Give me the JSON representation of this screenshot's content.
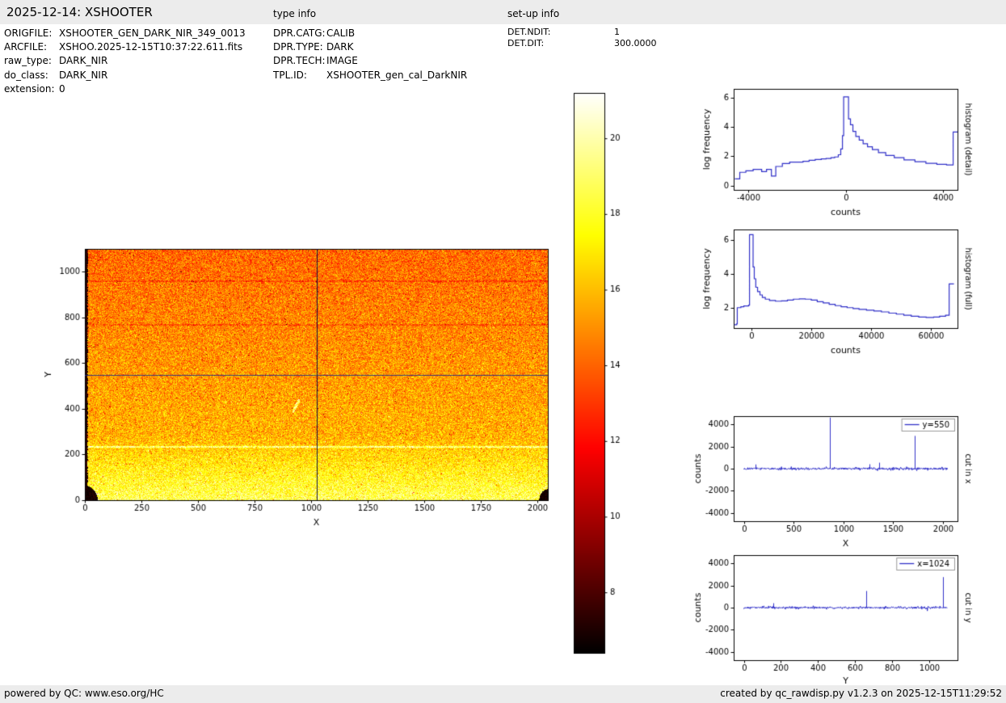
{
  "header": {
    "title": "2025-12-14: XSHOOTER",
    "type_info_label": "type info",
    "setup_info_label": "set-up info"
  },
  "metadata": {
    "left": [
      {
        "label": "ORIGFILE:",
        "value": "XSHOOTER_GEN_DARK_NIR_349_0013"
      },
      {
        "label": "ARCFILE:",
        "value": "XSHOO.2025-12-15T10:37:22.611.fits"
      },
      {
        "label": "raw_type:",
        "value": "DARK_NIR"
      },
      {
        "label": "do_class:",
        "value": "DARK_NIR"
      },
      {
        "label": "extension:",
        "value": "0"
      }
    ],
    "type_info": [
      {
        "label": "DPR.CATG:",
        "value": "CALIB"
      },
      {
        "label": "DPR.TYPE:",
        "value": "DARK"
      },
      {
        "label": "DPR.TECH:",
        "value": "IMAGE"
      },
      {
        "label": "TPL.ID:",
        "value": "XSHOOTER_gen_cal_DarkNIR"
      }
    ],
    "setup_info": [
      {
        "label": "DET.NDIT:",
        "value": "1"
      },
      {
        "label": "DET.DIT:",
        "value": "300.0000"
      }
    ]
  },
  "footer": {
    "left": "powered by QC: www.eso.org/HC",
    "right": "created by qc_rawdisp.py v1.2.3 on 2025-12-15T11:29:52"
  },
  "colors": {
    "plot_line": "#3030c8",
    "bar_background": "#ececec",
    "crosshair_vertical": "#14143c",
    "crosshair_horizontal": "#1b2a8a"
  },
  "chart_data": [
    {
      "id": "heatmap",
      "type": "heatmap",
      "xlabel": "X",
      "ylabel": "Y",
      "x_range": [
        0,
        2048
      ],
      "y_range": [
        0,
        1100
      ],
      "x_ticks": [
        0,
        250,
        500,
        750,
        1000,
        1250,
        1500,
        1750,
        2000
      ],
      "y_ticks": [
        0,
        200,
        400,
        600,
        800,
        1000
      ],
      "colormap": "hot",
      "value_range": [
        6.4,
        21.2
      ],
      "crosshair": {
        "x": 1024,
        "y": 550
      },
      "features": {
        "bright_row_y": 235,
        "dark_rows": [
          960,
          770
        ],
        "dark_left_edge": true,
        "dark_corners": [
          "bottom-left",
          "bottom-right"
        ],
        "bright_streak": {
          "x0": 915,
          "y0": 385,
          "x1": 950,
          "y1": 445
        }
      }
    },
    {
      "id": "colorbar",
      "type": "colorbar",
      "colormap": "hot",
      "range": [
        6.4,
        21.2
      ],
      "ticks": [
        8,
        10,
        12,
        14,
        16,
        18,
        20
      ]
    },
    {
      "id": "hist-detail",
      "type": "line",
      "xlabel": "counts",
      "ylabel": "log frequency",
      "right_label": "histogram (detail)",
      "x_range": [
        -4600,
        4600
      ],
      "y_range": [
        -0.3,
        6.6
      ],
      "x_ticks": [
        -4000,
        0,
        4000
      ],
      "y_ticks": [
        0,
        2,
        4,
        6
      ],
      "points": [
        [
          -4550,
          0.45
        ],
        [
          -4350,
          0.45
        ],
        [
          -4350,
          0.9
        ],
        [
          -4100,
          0.9
        ],
        [
          -4100,
          1.0
        ],
        [
          -3800,
          1.0
        ],
        [
          -3800,
          1.1
        ],
        [
          -3450,
          1.1
        ],
        [
          -3450,
          0.95
        ],
        [
          -3250,
          0.95
        ],
        [
          -3250,
          1.1
        ],
        [
          -3050,
          1.1
        ],
        [
          -3050,
          0.65
        ],
        [
          -2870,
          0.65
        ],
        [
          -2870,
          1.3
        ],
        [
          -2600,
          1.3
        ],
        [
          -2600,
          1.5
        ],
        [
          -2300,
          1.5
        ],
        [
          -2300,
          1.6
        ],
        [
          -2000,
          1.6
        ],
        [
          -1750,
          1.65
        ],
        [
          -1500,
          1.72
        ],
        [
          -1250,
          1.78
        ],
        [
          -1000,
          1.82
        ],
        [
          -800,
          1.85
        ],
        [
          -600,
          1.9
        ],
        [
          -450,
          1.95
        ],
        [
          -300,
          2.1
        ],
        [
          -200,
          2.5
        ],
        [
          -130,
          3.4
        ],
        [
          -80,
          6.05
        ],
        [
          60,
          6.05
        ],
        [
          120,
          4.55
        ],
        [
          200,
          4.15
        ],
        [
          300,
          3.7
        ],
        [
          420,
          3.35
        ],
        [
          560,
          3.1
        ],
        [
          720,
          2.85
        ],
        [
          900,
          2.65
        ],
        [
          1100,
          2.45
        ],
        [
          1350,
          2.25
        ],
        [
          1650,
          2.05
        ],
        [
          2000,
          1.9
        ],
        [
          2400,
          1.75
        ],
        [
          2850,
          1.62
        ],
        [
          3300,
          1.52
        ],
        [
          3750,
          1.45
        ],
        [
          4150,
          1.4
        ],
        [
          4380,
          1.4
        ],
        [
          4420,
          3.65
        ],
        [
          4600,
          3.65
        ]
      ]
    },
    {
      "id": "hist-full",
      "type": "line",
      "xlabel": "counts",
      "ylabel": "log frequency",
      "right_label": "histogram (full)",
      "x_range": [
        -6000,
        69000
      ],
      "y_range": [
        0.8,
        6.6
      ],
      "x_ticks": [
        0,
        20000,
        40000,
        60000
      ],
      "y_ticks": [
        2,
        4,
        6
      ],
      "points": [
        [
          -5800,
          1.0
        ],
        [
          -5000,
          1.05
        ],
        [
          -4800,
          2.0
        ],
        [
          -3600,
          2.05
        ],
        [
          -2600,
          2.1
        ],
        [
          -1000,
          2.15
        ],
        [
          -700,
          6.3
        ],
        [
          200,
          6.3
        ],
        [
          500,
          4.4
        ],
        [
          900,
          3.7
        ],
        [
          1400,
          3.2
        ],
        [
          2000,
          2.95
        ],
        [
          2800,
          2.75
        ],
        [
          3600,
          2.6
        ],
        [
          4600,
          2.5
        ],
        [
          6000,
          2.42
        ],
        [
          8000,
          2.38
        ],
        [
          10000,
          2.4
        ],
        [
          12000,
          2.45
        ],
        [
          14000,
          2.5
        ],
        [
          16000,
          2.52
        ],
        [
          18000,
          2.5
        ],
        [
          20000,
          2.45
        ],
        [
          22000,
          2.35
        ],
        [
          24000,
          2.28
        ],
        [
          26000,
          2.2
        ],
        [
          28000,
          2.12
        ],
        [
          30000,
          2.05
        ],
        [
          32000,
          2.0
        ],
        [
          34000,
          1.95
        ],
        [
          36000,
          1.9
        ],
        [
          38500,
          1.85
        ],
        [
          41000,
          1.8
        ],
        [
          43500,
          1.75
        ],
        [
          46000,
          1.68
        ],
        [
          48500,
          1.62
        ],
        [
          51000,
          1.55
        ],
        [
          53500,
          1.5
        ],
        [
          56000,
          1.45
        ],
        [
          58500,
          1.42
        ],
        [
          61000,
          1.45
        ],
        [
          63000,
          1.5
        ],
        [
          65000,
          1.55
        ],
        [
          66200,
          3.4
        ],
        [
          67800,
          3.4
        ]
      ]
    },
    {
      "id": "cut-x",
      "type": "line",
      "legend": "y=550",
      "xlabel": "X",
      "ylabel": "counts",
      "right_label": "cut in x",
      "x_range": [
        -102,
        2150
      ],
      "y_range": [
        -4730,
        4730
      ],
      "data_x_extent": [
        0,
        2048
      ],
      "x_ticks": [
        0,
        500,
        1000,
        1500,
        2000
      ],
      "y_ticks": [
        -4000,
        -2000,
        0,
        2000,
        4000
      ],
      "noise_amp": 190,
      "spikes": [
        [
          120,
          380
        ],
        [
          868,
          4600
        ],
        [
          1265,
          400
        ],
        [
          1360,
          540
        ],
        [
          1720,
          2950
        ]
      ]
    },
    {
      "id": "cut-y",
      "type": "line",
      "legend": "x=1024",
      "xlabel": "Y",
      "ylabel": "counts",
      "right_label": "cut in y",
      "x_range": [
        -55,
        1155
      ],
      "y_range": [
        -4730,
        4730
      ],
      "data_x_extent": [
        0,
        1100
      ],
      "x_ticks": [
        0,
        200,
        400,
        600,
        800,
        1000
      ],
      "y_ticks": [
        -4000,
        -2000,
        0,
        2000,
        4000
      ],
      "noise_amp": 160,
      "spikes": [
        [
          160,
          400
        ],
        [
          660,
          1500
        ],
        [
          1078,
          2750
        ]
      ]
    }
  ]
}
